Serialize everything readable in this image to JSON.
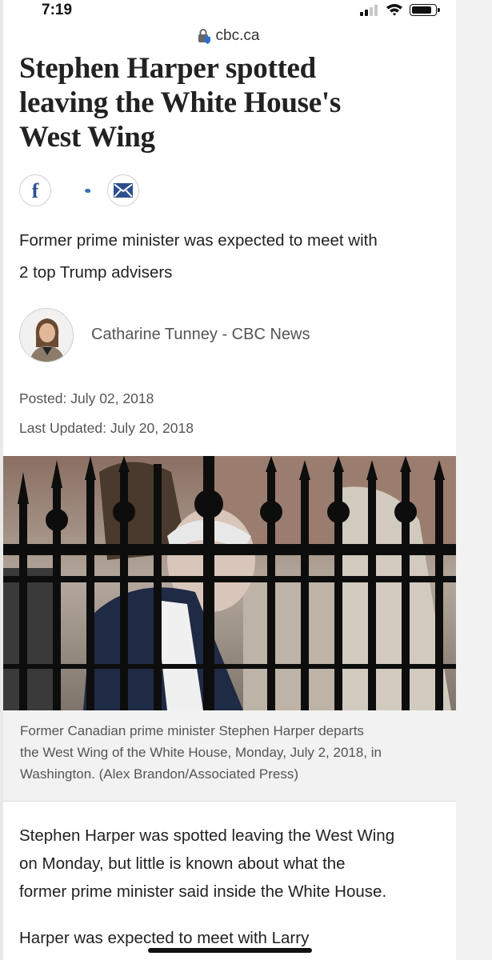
{
  "status_bar": {
    "time": "7:19",
    "signal_icon": "cellular-signal-icon",
    "wifi_icon": "wifi-icon",
    "battery_icon": "battery-icon",
    "battery_level": 0.9
  },
  "browser": {
    "url": "cbc.ca",
    "lock_icon": "lock-shield-icon"
  },
  "article": {
    "headline_lines": [
      "Stephen Harper spotted",
      "leaving the White House's",
      "West Wing"
    ],
    "share": {
      "facebook_label": "f",
      "facebook_icon": "facebook-icon",
      "twitter_icon": "twitter-icon",
      "email_icon": "email-icon"
    },
    "dek_lines": [
      "Former prime minister was expected to meet with",
      "2 top Trump advisers"
    ],
    "author": "Catharine Tunney - CBC News",
    "posted": "Posted: July 02, 2018",
    "updated": "Last Updated: July 20, 2018",
    "caption_lines": [
      "Former Canadian prime minister Stephen Harper departs",
      "the West Wing of the White House, Monday, July 2, 2018, in",
      "Washington. (Alex Brandon/Associated Press)"
    ],
    "paragraph1_lines": [
      "Stephen Harper was spotted leaving the West Wing",
      "on Monday, but little is known about what the",
      "former prime minister said inside the White House."
    ],
    "paragraph2_line": "Harper was expected to meet with Larry"
  },
  "colors": {
    "headline": "#222222",
    "facebook": "#2d4f8e",
    "muted_text": "#555555",
    "caption_bg": "#f2f2f2"
  }
}
